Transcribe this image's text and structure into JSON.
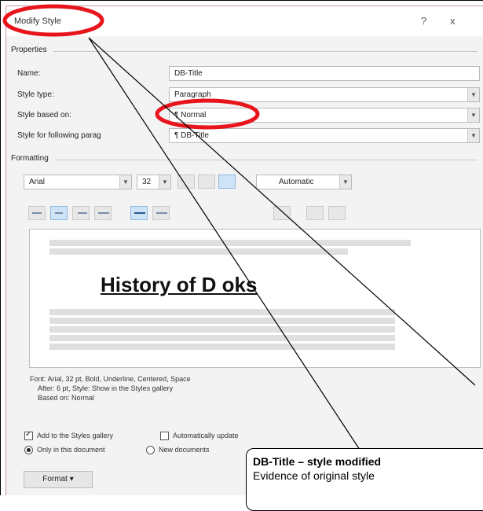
{
  "dialog": {
    "title": "Modify Style",
    "help_label": "?",
    "close_label": "x"
  },
  "properties": {
    "section_label": "Properties",
    "name_label": "Name:",
    "name_value": "DB-Title",
    "style_type_label": "Style type:",
    "style_type_value": "Paragraph",
    "based_on_label": "Style based on:",
    "based_on_value": "¶ Normal",
    "following_label": "Style for following parag",
    "following_value": "¶ DB-Title"
  },
  "formatting": {
    "section_label": "Formatting",
    "font": "Arial",
    "size": "32",
    "color": "Automatic"
  },
  "preview": {
    "sample_text": "History of D          oks"
  },
  "description": {
    "line1": "Font: Arial, 32 pt, Bold, Underline, Centered, Space",
    "line2": "After:  6 pt, Style: Show in the Styles gallery",
    "line3": "Based on: Normal"
  },
  "options": {
    "add_to_gallery": "Add to the Styles gallery",
    "auto_update": "Automatically update",
    "only_this_doc": "Only in this document",
    "new_docs": "New documents"
  },
  "buttons": {
    "format": "Format ▾"
  },
  "callout": {
    "title": "DB-Title – style modified",
    "subtitle": "Evidence of original style"
  },
  "colors": {
    "highlight_ring": "#e8141c",
    "dialog_border": "#c89aa8"
  }
}
